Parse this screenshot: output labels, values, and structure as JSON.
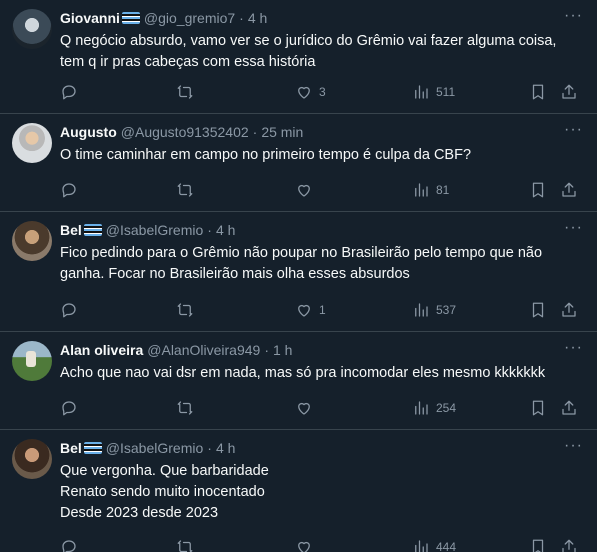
{
  "tweets": [
    {
      "name": "Giovanni",
      "handle": "@gio_gremio7",
      "dot": "·",
      "time": "4 h",
      "lines": [
        "Q negócio absurdo, vamo ver se o jurídico do Grêmio vai fazer alguma coisa,",
        "tem q ir pras cabeças com essa história"
      ],
      "likes": "3",
      "views": "511"
    },
    {
      "name": "Augusto",
      "handle": "@Augusto91352402",
      "dot": "·",
      "time": "25 min",
      "lines": [
        "O time caminhar em campo no primeiro tempo é culpa da CBF?"
      ],
      "likes": "",
      "views": "81"
    },
    {
      "name": "Bel",
      "handle": "@IsabelGremio",
      "dot": "·",
      "time": "4 h",
      "lines": [
        "Fico pedindo para o Grêmio não poupar no Brasileirão pelo tempo que não",
        "ganha. Focar no Brasileirão mais olha esses absurdos"
      ],
      "likes": "1",
      "views": "537"
    },
    {
      "name": "Alan oliveira",
      "handle": "@AlanOliveira949",
      "dot": "·",
      "time": "1 h",
      "lines": [
        "Acho que nao vai dsr em nada, mas só pra incomodar eles mesmo kkkkkkk"
      ],
      "likes": "",
      "views": "254"
    },
    {
      "name": "Bel",
      "handle": "@IsabelGremio",
      "dot": "·",
      "time": "4 h",
      "lines": [
        "Que vergonha. Que barbaridade",
        "Renato sendo muito inocentado",
        "Desde 2023 desde 2023"
      ],
      "likes": "",
      "views": "444"
    }
  ],
  "more_icon": "···",
  "icons": [
    "avatar",
    "reply-icon",
    "retweet-icon",
    "like-icon",
    "views-icon",
    "bookmark-icon",
    "share-icon",
    "more-icon",
    "flag-icon"
  ]
}
